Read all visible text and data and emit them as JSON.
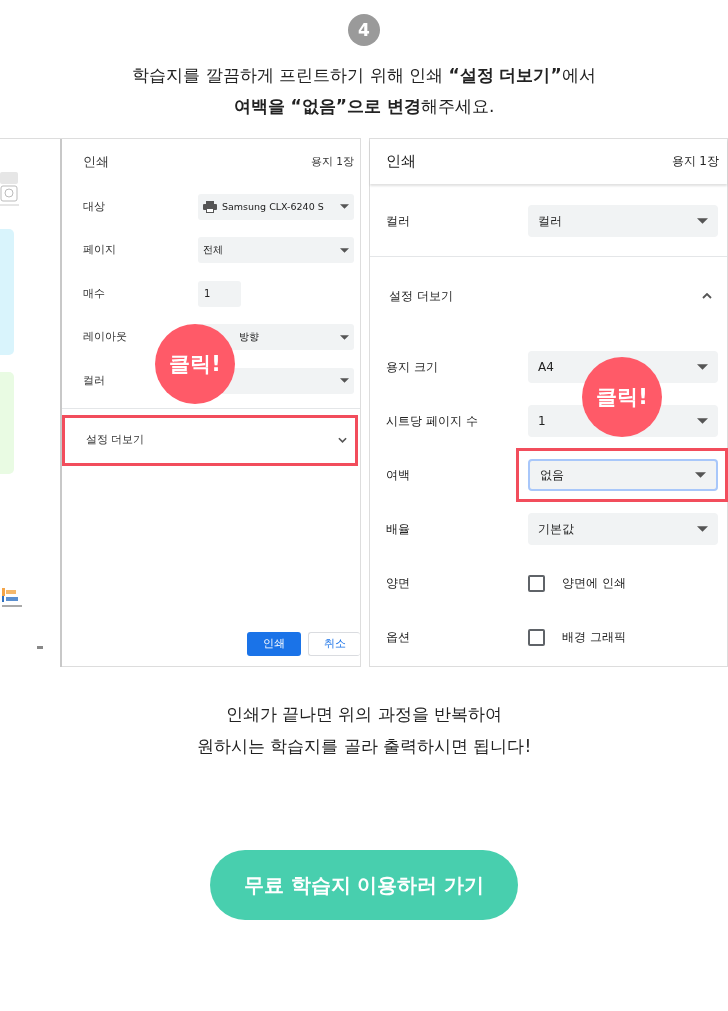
{
  "step_number": "4",
  "instruction": [
    "학습지를 깔끔하게 프린트하기 위해 인쇄 **“설정 더보기”**에서",
    "**여백을 “없음”으로 변경**해주세요."
  ],
  "left_dialog": {
    "title": "인쇄",
    "sheets": "용지 1장",
    "rows": [
      {
        "label": "대상",
        "kind": "printer",
        "value": "Samsung CLX-6240 S"
      },
      {
        "label": "페이지",
        "kind": "select",
        "value": "전체"
      },
      {
        "label": "매수",
        "kind": "number",
        "value": "1"
      },
      {
        "label": "레이아웃",
        "kind": "select",
        "value": "방향"
      },
      {
        "label": "컬러",
        "kind": "select"
      }
    ],
    "more_settings": {
      "label": "설정 더보기",
      "expanded": false,
      "highlighted": true
    },
    "buttons": [
      {
        "label": "인쇄",
        "kind": "primary"
      },
      {
        "label": "취소",
        "kind": "secondary"
      }
    ],
    "badge": "클릭!"
  },
  "right_dialog": {
    "title": "인쇄",
    "sheets": "용지 1장",
    "top_rows": [
      {
        "label": "컬러",
        "kind": "select",
        "value": "컬러",
        "highlighted": false
      }
    ],
    "more_settings": {
      "label": "설정 더보기",
      "expanded": true,
      "highlighted": false
    },
    "rows": [
      {
        "label": "용지 크기",
        "kind": "select",
        "value": "A4",
        "highlighted": false
      },
      {
        "label": "시트당 페이지 수",
        "kind": "select",
        "value": "1",
        "highlighted": false
      },
      {
        "label": "여백",
        "kind": "select",
        "value": "없음",
        "highlighted": true
      },
      {
        "label": "배율",
        "kind": "select",
        "value": "기본값",
        "highlighted": false
      },
      {
        "label": "양면",
        "kind": "checkbox",
        "value": "양면에 인쇄",
        "checked": false,
        "highlighted": false
      },
      {
        "label": "옵션",
        "kind": "checkbox",
        "value": "배경 그래픽",
        "checked": false,
        "highlighted": false
      }
    ],
    "badge": "클릭!"
  },
  "closing": [
    "인쇄가 끝나면 위의 과정을 반복하여",
    "원하시는 학습지를 골라 출력하시면 됩니다!"
  ],
  "cta_button": "무료 학습지 이용하러 가기"
}
